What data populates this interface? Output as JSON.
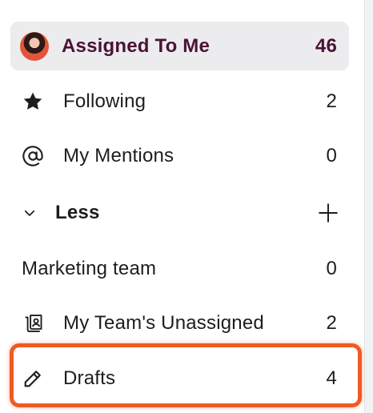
{
  "nav": {
    "assigned": {
      "label": "Assigned To Me",
      "count": "46"
    },
    "following": {
      "label": "Following",
      "count": "2"
    },
    "mentions": {
      "label": "My Mentions",
      "count": "0"
    },
    "less": {
      "label": "Less"
    },
    "marketing": {
      "label": "Marketing team",
      "count": "0"
    },
    "team_unassigned": {
      "label": "My Team's Unassigned",
      "count": "2"
    },
    "drafts": {
      "label": "Drafts",
      "count": "4"
    }
  },
  "icons": {
    "following": "star-icon",
    "mentions": "at-sign-icon",
    "less_toggle": "chevron-down-icon",
    "add": "plus-icon",
    "team_unassigned": "team-inbox-icon",
    "drafts": "pencil-icon"
  },
  "colors": {
    "selected_background": "#ececee",
    "selected_text": "#4a1236",
    "highlight_border": "#f05a22"
  }
}
